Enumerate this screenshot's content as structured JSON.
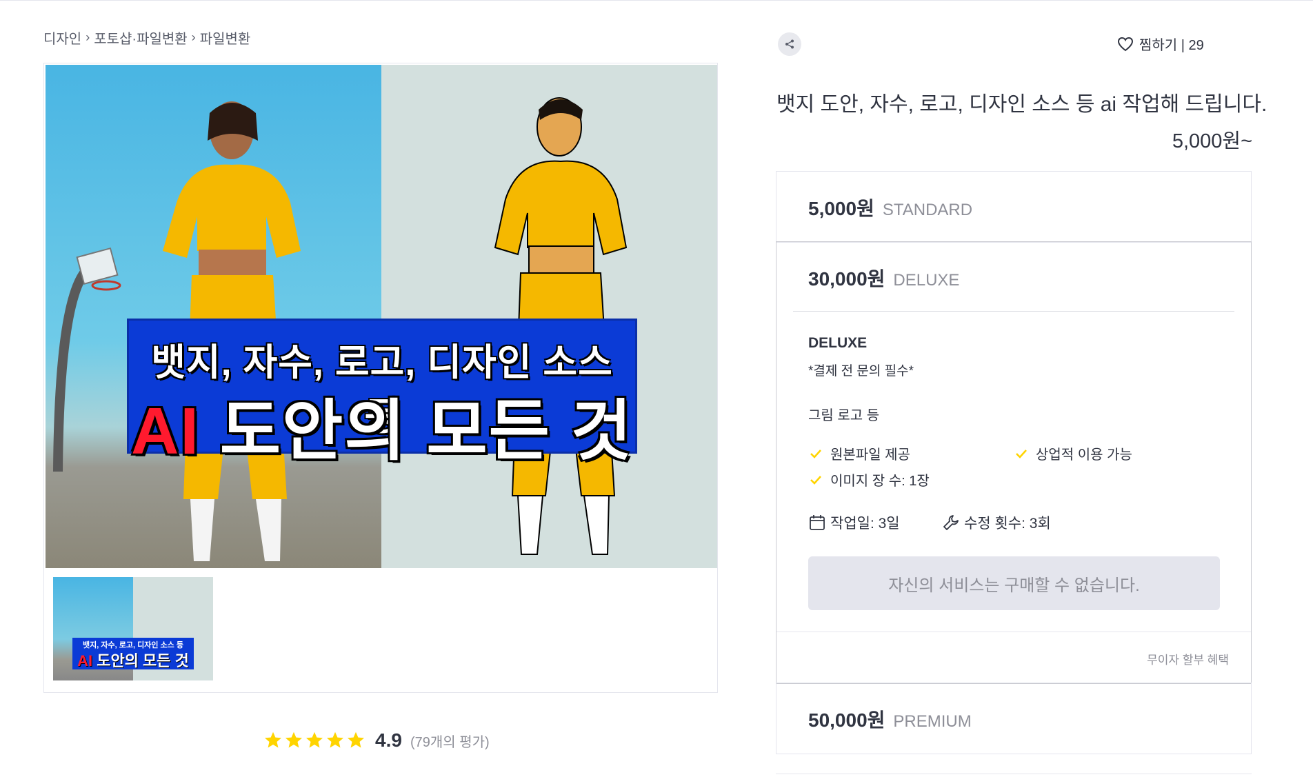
{
  "breadcrumb": [
    "디자인",
    "포토샵·파일변환",
    "파일변환"
  ],
  "gallery": {
    "banner_line1": "뱃지, 자수, 로고, 디자인 소스 등",
    "banner_line2_ai": "AI",
    "banner_line2_rest": " 도안의 모든 것"
  },
  "rating": {
    "score": "4.9",
    "count_label": "(79개의 평가)",
    "stars": 5
  },
  "header": {
    "like_label": "찜하기 | 29",
    "title": "뱃지 도안, 자수, 로고, 디자인 소스 등 ai 작업해 드립니다.",
    "price_from": "5,000원~"
  },
  "packages": [
    {
      "price": "5,000원",
      "name": "STANDARD"
    },
    {
      "price": "30,000원",
      "name": "DELUXE"
    },
    {
      "price": "50,000원",
      "name": "PREMIUM"
    }
  ],
  "deluxe_detail": {
    "title": "DELUXE",
    "note": "*결제 전 문의 필수*",
    "description": "그림 로고 등",
    "features": [
      "원본파일 제공",
      "상업적 이용 가능",
      "이미지 장 수: 1장"
    ],
    "work_days": "작업일: 3일",
    "revisions": "수정 횟수: 3회",
    "buy_label": "자신의 서비스는 구매할 수 없습니다.",
    "installment": "무이자 할부 혜택"
  },
  "colors": {
    "star": "#ffd400",
    "check": "#ffd400",
    "banner": "#0b3bd6",
    "ai_text": "#ff1a2e",
    "button_bg": "#e4e5ed"
  }
}
